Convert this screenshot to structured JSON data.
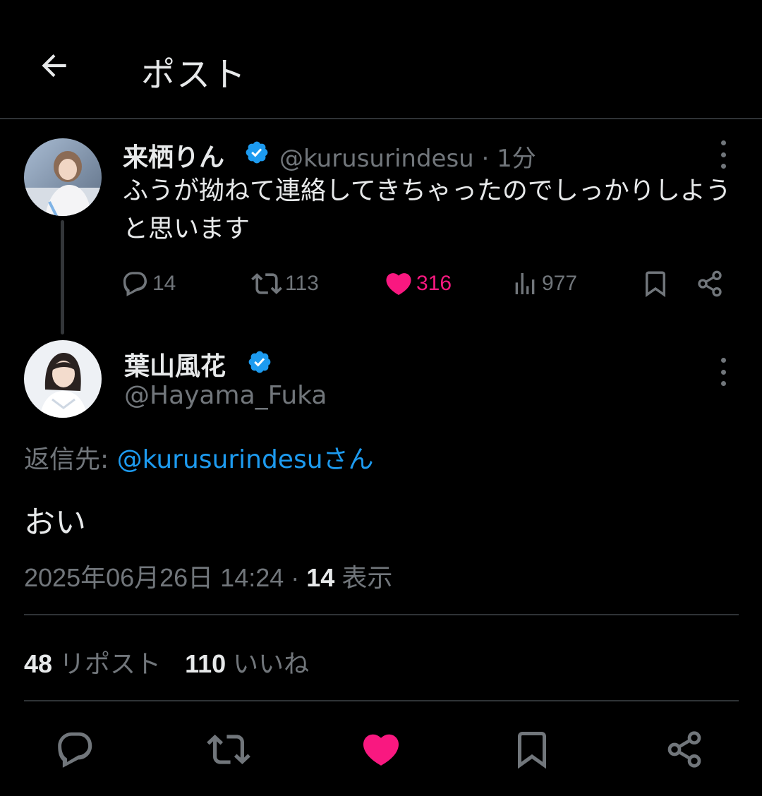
{
  "header": {
    "title": "ポスト"
  },
  "parent_post": {
    "name": "来栖りん",
    "handle": "@kurusurindesu",
    "time": "· 1分",
    "text": "ふうが拗ねて連絡してきちゃったのでしっかりしようと思います",
    "replies": "14",
    "reposts": "113",
    "likes": "316",
    "views": "977"
  },
  "main_post": {
    "name": "葉山風花",
    "handle": "@Hayama_Fuka",
    "reply_to_label": "返信先:",
    "reply_to_mention": "@kurusurindesuさん",
    "text": "おい",
    "timestamp": "2025年06月26日 14:24 · ",
    "view_count": "14",
    "view_label": " 表示",
    "repost_count": "48",
    "repost_label": " リポスト",
    "like_count": "110",
    "like_label": " いいね"
  },
  "colors": {
    "accent": "#1d9bf0",
    "like": "#f91880",
    "muted": "#71767b",
    "background": "#000000"
  },
  "icons": [
    "back-arrow-icon",
    "verified-icon",
    "more-icon",
    "reply-icon",
    "repost-icon",
    "like-icon",
    "views-icon",
    "bookmark-icon",
    "share-icon"
  ]
}
